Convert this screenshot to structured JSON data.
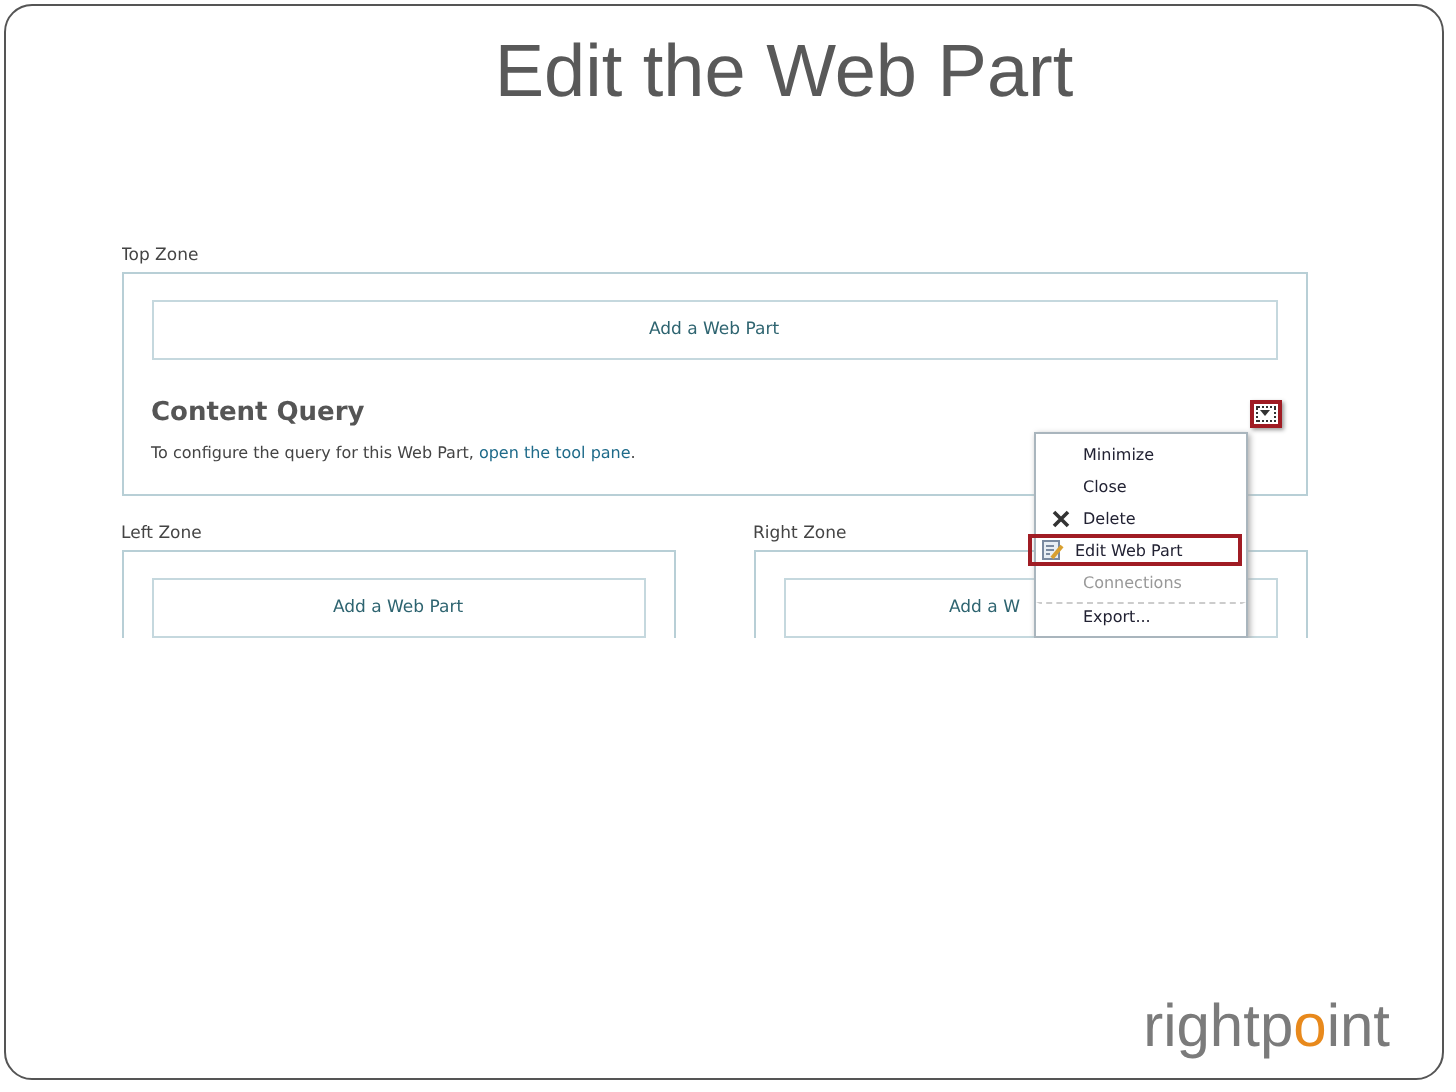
{
  "slide_title": "Edit the Web Part",
  "page": {
    "top_zone": {
      "label": "Top Zone",
      "add_button": "Add a Web Part",
      "web_part": {
        "title": "Content Query",
        "text": "To configure the query for this Web Part, ",
        "link": "open the tool pane",
        "after_link": "."
      }
    },
    "left_zone": {
      "label": "Left Zone",
      "add_button": "Add a Web Part"
    },
    "right_zone": {
      "label": "Right Zone",
      "add_button": "Add a W"
    },
    "menu": [
      {
        "label": "Minimize",
        "kind": "plain",
        "disabled": false,
        "selected": false
      },
      {
        "label": "Close",
        "kind": "plain",
        "disabled": false,
        "selected": false
      },
      {
        "label": "Delete",
        "kind": "delete",
        "disabled": false,
        "selected": false
      },
      {
        "label": "Edit Web Part",
        "kind": "edit",
        "disabled": false,
        "selected": true
      },
      {
        "label": "Connections",
        "kind": "plain",
        "disabled": true,
        "selected": false
      },
      {
        "label": "Export...",
        "kind": "separated",
        "disabled": false,
        "selected": false
      }
    ]
  },
  "logo": {
    "parts": [
      {
        "text": "rightp",
        "accent": false
      },
      {
        "text": "o",
        "accent": true
      },
      {
        "text": "int",
        "accent": false
      }
    ]
  }
}
